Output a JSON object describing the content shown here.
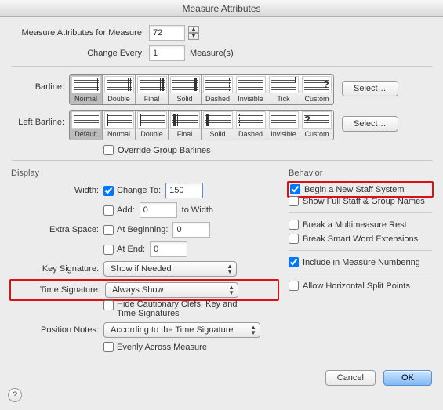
{
  "title": "Measure Attributes",
  "header": {
    "measure_label": "Measure Attributes for Measure:",
    "measure_value": "72",
    "change_every_label": "Change Every:",
    "change_every_value": "1",
    "measures_suffix": "Measure(s)"
  },
  "barline": {
    "label": "Barline:",
    "options": [
      "Normal",
      "Double",
      "Final",
      "Solid",
      "Dashed",
      "Invisible",
      "Tick",
      "Custom"
    ],
    "selected": "Normal",
    "select_button": "Select…"
  },
  "left_barline": {
    "label": "Left Barline:",
    "options": [
      "Default",
      "Normal",
      "Double",
      "Final",
      "Solid",
      "Dashed",
      "Invisible",
      "Custom"
    ],
    "selected": "Default",
    "select_button": "Select…"
  },
  "override_group": "Override Group Barlines",
  "display": {
    "title": "Display",
    "width_label": "Width:",
    "change_to_label": "Change To:",
    "change_to_value": "150",
    "add_label": "Add:",
    "add_value": "0",
    "add_suffix": "to Width",
    "extra_space_label": "Extra Space:",
    "at_beginning_label": "At Beginning:",
    "at_beginning_value": "0",
    "at_end_label": "At End:",
    "at_end_value": "0",
    "key_sig_label": "Key Signature:",
    "key_sig_value": "Show if Needed",
    "time_sig_label": "Time Signature:",
    "time_sig_value": "Always Show",
    "hide_cautionary": "Hide Cautionary Clefs, Key and Time Signatures",
    "position_notes_label": "Position Notes:",
    "position_notes_value": "According to the Time Signature",
    "evenly": "Evenly Across Measure"
  },
  "behavior": {
    "title": "Behavior",
    "begin_new_staff": "Begin a New Staff System",
    "show_full_names": "Show Full Staff & Group Names",
    "break_multimeasure": "Break a Multimeasure Rest",
    "break_smart_word": "Break Smart Word Extensions",
    "include_numbering": "Include in Measure Numbering",
    "allow_split": "Allow Horizontal Split Points"
  },
  "buttons": {
    "cancel": "Cancel",
    "ok": "OK"
  }
}
